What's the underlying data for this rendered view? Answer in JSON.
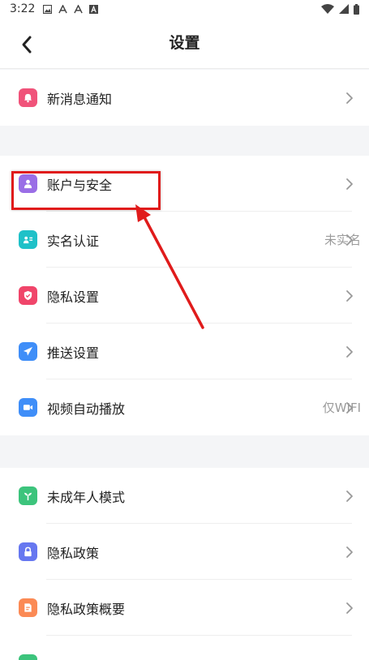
{
  "status_bar": {
    "time": "3:22"
  },
  "header": {
    "title": "设置"
  },
  "groups": [
    {
      "items": [
        {
          "label": "新消息通知",
          "value": "",
          "color": "#f0537a",
          "icon": "bell-icon"
        }
      ]
    },
    {
      "items": [
        {
          "label": "账户与安全",
          "value": "",
          "color": "#9a6ee6",
          "icon": "person-icon"
        },
        {
          "label": "实名认证",
          "value": "未实名",
          "color": "#1fc1c8",
          "icon": "id-card-icon"
        },
        {
          "label": "隐私设置",
          "value": "",
          "color": "#f0456a",
          "icon": "shield-icon"
        },
        {
          "label": "推送设置",
          "value": "",
          "color": "#3f8ef8",
          "icon": "paper-plane-icon"
        },
        {
          "label": "视频自动播放",
          "value": "仅WIFI",
          "color": "#3f8ef8",
          "icon": "video-icon"
        }
      ]
    },
    {
      "items": [
        {
          "label": "未成年人模式",
          "value": "",
          "color": "#3cc47c",
          "icon": "sprout-icon"
        },
        {
          "label": "隐私政策",
          "value": "",
          "color": "#6677f0",
          "icon": "lock-icon"
        },
        {
          "label": "隐私政策概要",
          "value": "",
          "color": "#fb8a55",
          "icon": "document-icon"
        }
      ]
    }
  ],
  "annotation": {
    "color": "#e01b1b"
  }
}
